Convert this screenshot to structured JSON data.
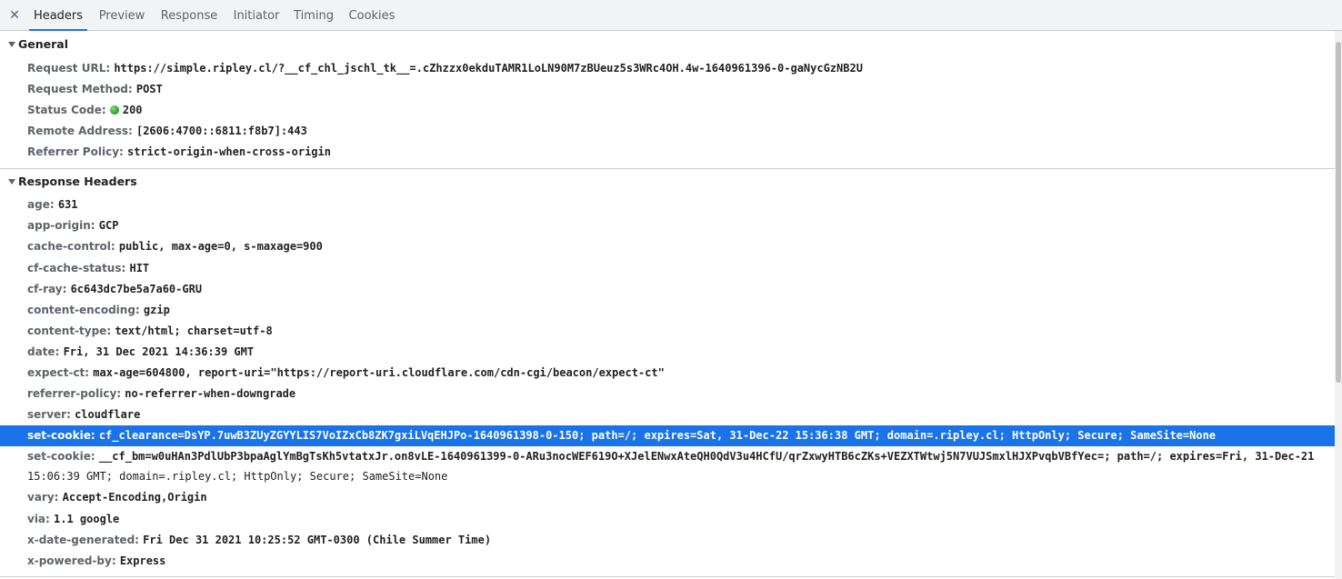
{
  "tabs": [
    {
      "label": "Headers"
    },
    {
      "label": "Preview"
    },
    {
      "label": "Response"
    },
    {
      "label": "Initiator"
    },
    {
      "label": "Timing"
    },
    {
      "label": "Cookies"
    }
  ],
  "close_glyph": "✕",
  "general": {
    "title": "General",
    "rows": [
      {
        "key": "Request URL:",
        "value": "https://simple.ripley.cl/?__cf_chl_jschl_tk__=.cZhzzx0ekduTAMR1LoLN90M7zBUeuz5s3WRc4OH.4w-1640961396-0-gaNycGzNB2U"
      },
      {
        "key": "Request Method:",
        "value": "POST"
      },
      {
        "key": "Status Code:",
        "value": "200"
      },
      {
        "key": "Remote Address:",
        "value": "[2606:4700::6811:f8b7]:443"
      },
      {
        "key": "Referrer Policy:",
        "value": "strict-origin-when-cross-origin"
      }
    ]
  },
  "response_headers": {
    "title": "Response Headers",
    "rows": [
      {
        "key": "age:",
        "value": "631"
      },
      {
        "key": "app-origin:",
        "value": "GCP"
      },
      {
        "key": "cache-control:",
        "value": "public, max-age=0, s-maxage=900"
      },
      {
        "key": "cf-cache-status:",
        "value": "HIT"
      },
      {
        "key": "cf-ray:",
        "value": "6c643dc7be5a7a60-GRU"
      },
      {
        "key": "content-encoding:",
        "value": "gzip"
      },
      {
        "key": "content-type:",
        "value": "text/html; charset=utf-8"
      },
      {
        "key": "date:",
        "value": "Fri, 31 Dec 2021 14:36:39 GMT"
      },
      {
        "key": "expect-ct:",
        "value": "max-age=604800, report-uri=\"https://report-uri.cloudflare.com/cdn-cgi/beacon/expect-ct\""
      },
      {
        "key": "referrer-policy:",
        "value": "no-referrer-when-downgrade"
      },
      {
        "key": "server:",
        "value": "cloudflare"
      },
      {
        "key": "set-cookie:",
        "value": "cf_clearance=DsYP.7uwB3ZUyZGYYLIS7VoIZxCb8ZK7gxiLVqEHJPo-1640961398-0-150; path=/; expires=Sat, 31-Dec-22 15:36:38 GMT; domain=.ripley.cl; HttpOnly; Secure; SameSite=None"
      },
      {
        "key": "set-cookie:",
        "value": "__cf_bm=w0uHAn3PdlUbP3bpaAglYmBgTsKh5vtatxJr.on8vLE-1640961399-0-ARu3nocWEF619O+XJelENwxAteQH0QdV3u4HCfU/qrZxwyHTB6cZKs+VEZXTWtwj5N7VUJSmxlHJXPvqbVBfYec=; path=/; expires=Fri, 31-Dec-21",
        "value_cont": "15:06:39 GMT; domain=.ripley.cl; HttpOnly; Secure; SameSite=None"
      },
      {
        "key": "vary:",
        "value": "Accept-Encoding,Origin"
      },
      {
        "key": "via:",
        "value": "1.1 google"
      },
      {
        "key": "x-date-generated:",
        "value": "Fri Dec 31 2021 10:25:52 GMT-0300 (Chile Summer Time)"
      },
      {
        "key": "x-powered-by:",
        "value": "Express"
      }
    ]
  },
  "colors": {
    "tab_active_underline": "#1a73e8",
    "selected_row_bg": "#1a73e8",
    "status_ok": "#1e9e1e"
  }
}
